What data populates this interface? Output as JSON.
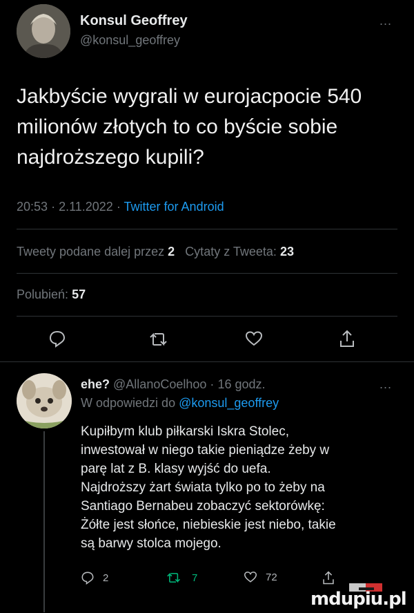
{
  "tweet": {
    "author_name": "Konsul Geoffrey",
    "author_handle": "@konsul_geoffrey",
    "more": "...",
    "text_lines": [
      "Jakbyście wygrali w eurojacpocie 540",
      "milionów złotych to co byście sobie",
      "najdroższego kupili?"
    ],
    "time": "20:53",
    "date": "2.11.2022",
    "separator": "·",
    "client": "Twitter for Android",
    "retweets_label": "Tweety podane dalej przez",
    "retweets_count": "2",
    "quotes_label": "Cytaty z Tweeta:",
    "quotes_count": "23",
    "likes_label": "Polubień:",
    "likes_count": "57",
    "actions": [
      "reply-icon",
      "retweet-icon",
      "like-icon",
      "share-icon"
    ]
  },
  "reply": {
    "author_name": "ehe?",
    "author_handle": "@AllanoCoelhoo",
    "time_ago": "16 godz.",
    "more": "...",
    "replying_to_label": "W odpowiedzi do",
    "replying_to_handle": "@konsul_geoffrey",
    "text_lines": [
      "Kupiłbym klub piłkarski Iskra Stolec,",
      "inwestował w niego takie pieniądze żeby w",
      "parę lat z B. klasy wyjść do uefa.",
      "Najdroższy żart świata tylko po to żeby na",
      "Santiago Bernabeu zobaczyć sektorówkę:",
      "Żółte jest słońce, niebieskie jest niebo, takie",
      "są barwy stolca mojego."
    ],
    "reply_count": "2",
    "retweet_count": "7",
    "like_count": "72",
    "retweet_color": "#00ba7c"
  },
  "watermark": "mdupiu.pl"
}
